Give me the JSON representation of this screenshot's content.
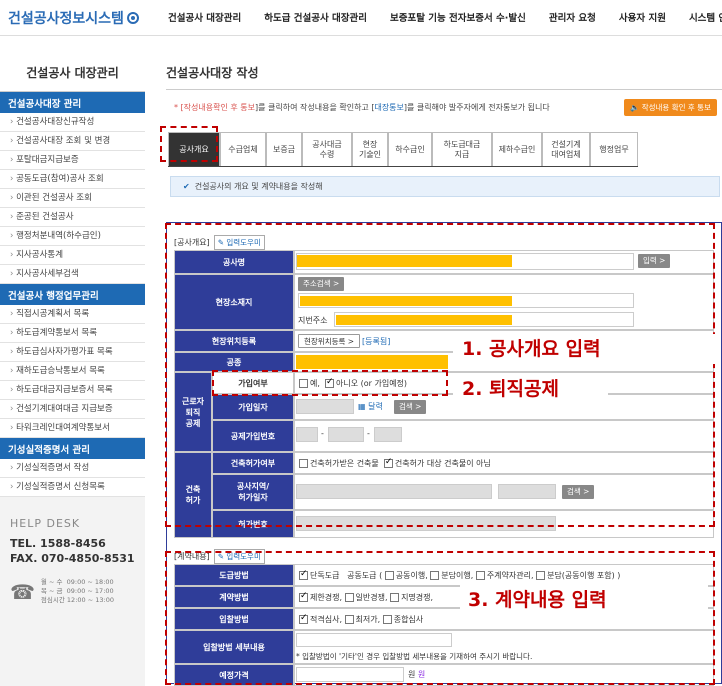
{
  "header": {
    "logo": "건설공사정보시스템",
    "nav": [
      "건설공사 대장관리",
      "하도급 건설공사 대장관리",
      "보증포탈 기능 전자보증서 수·발신",
      "관리자 요청",
      "사용자 지원",
      "시스템 안내"
    ]
  },
  "sidebar": {
    "title": "건설공사 대장관리",
    "sections": [
      {
        "label": "건설공사대장 관리",
        "items": [
          "건설공사대장신규작성",
          "건설공사대장 조회 및 변경",
          "포탈대금지급보증",
          "공동도급(참여)공사 조회",
          "이관된 건설공사 조회",
          "준공된 건설공사",
          "행정처분내역(하수급인)",
          "지사공사통계",
          "지사공사세부검색"
        ]
      },
      {
        "label": "건설공사 행정업무관리",
        "items": [
          "직접시공계획서 목록",
          "하도급계약통보서 목록",
          "하도급심사자가평가표 목록",
          "재하도급승낙통보서 목록",
          "하도급대금지급보증서 목록",
          "건설기계대여대금 지급보증",
          "타워크레인대여계약통보서"
        ]
      },
      {
        "label": "기성실적증명서 관리",
        "items": [
          "기성실적증명서 작성",
          "기성실적증명서 신청목록"
        ]
      }
    ]
  },
  "helpdesk": {
    "title": "HELP DESK",
    "tel": "TEL. 1588-8456",
    "fax": "FAX. 070-4850-8531",
    "hours_labels": [
      "월 ~ 수",
      "목 ~ 금",
      "점심시간"
    ],
    "hours_values": [
      "09:00 ~ 18:00",
      "09:00 ~ 17:00",
      "12:00 ~ 13:00"
    ]
  },
  "main": {
    "title": "건설공사대장 작성",
    "notice_prefix": "* [",
    "notice_red": "작성내용확인 후 통보",
    "notice_mid": "]를 클릭하여 작성내용을 확인하고 [",
    "notice_blue": "대장통보",
    "notice_suffix": "]를 클릭해야 발주자에게 전자통보가 됩니다",
    "notice_button": "작성내용 확인 후 통보",
    "tabs": [
      "공사개요",
      "수급업체",
      "보증금",
      "공사대금\n수령",
      "현장\n기술인",
      "하수급인",
      "하도급대금\n지급",
      "제하수급인",
      "건설기계\n대여업체",
      "행정업무"
    ],
    "info": "건설공사의 개요 및 계약내용을 작성해"
  },
  "overview": {
    "header": "[공사개요]",
    "help": "입력도우미",
    "labels": {
      "name": "공사명",
      "address": "현장소재지",
      "location": "현장위치등록",
      "type": "공종",
      "retire_group": "근로자\n퇴직\n공제",
      "join": "가입여부",
      "join_date": "가입일자",
      "join_no": "공제가입번호",
      "permit_group": "건축\n허가",
      "permit_yn": "건축허가여부",
      "permit_area": "공사지역/\n허가일자",
      "permit_no": "허가번호"
    },
    "enter_btn": "입력 >",
    "addr_btn": "주소검색 >",
    "lot_label": "지번주소",
    "loc_btn": "현장위치등록 >",
    "loc_link": "[등록됨]",
    "join_yes": "예,",
    "join_no_opt": "아니오 (or 가입예정)",
    "calendar": "달력",
    "search_btn": "검색 >",
    "permit_opt1": "건축허가받은 건축물",
    "permit_opt2": "건축허가 대상 건축물이 아님"
  },
  "contract": {
    "header": "[계약내용]",
    "help": "입력도우미",
    "labels": {
      "method": "도급방법",
      "contract_method": "계약방법",
      "bid_method": "입찰방법",
      "bid_detail": "입찰방법 세부내용",
      "price": "예정가격"
    },
    "method_opts": [
      "단독도급",
      "공동도급 (",
      "공동이행,",
      "분담이행,",
      "주계약자관리,",
      "분담(공동이행 포함) )"
    ],
    "contract_opts": [
      "제한경쟁,",
      "일반경쟁,",
      "지명경쟁,"
    ],
    "bid_opts": [
      "적격심사,",
      "최저가,",
      "종합심사"
    ],
    "bid_note": "* 입찰방법이 '기타'인 경우 입찰방법 세부내용을 기재하여 주시기 바랍니다.",
    "won": "원"
  },
  "annotations": [
    "1. 공사개요 입력",
    "2. 퇴직공제",
    "3. 계약내용 입력"
  ],
  "colors": {
    "navy": "#2f3d99",
    "highlight": "#ffc000",
    "annotation": "#c00000",
    "brand": "#1e6ab4"
  }
}
